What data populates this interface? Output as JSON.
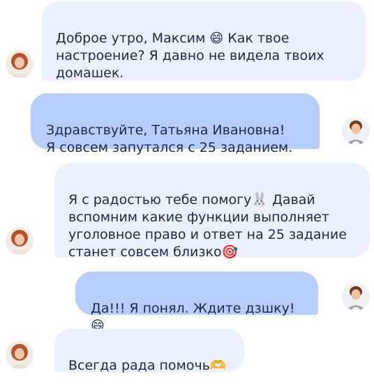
{
  "chat": {
    "messages": [
      {
        "sender": "teacher",
        "direction": "incoming",
        "text": "Доброе утро, Максим 😄 Как твое\nнастроение? Я давно не видела твоих\nдомашек."
      },
      {
        "sender": "student",
        "direction": "outgoing",
        "text": "Здравствуйте, Татьяна Ивановна!\nЯ совсем запутался с 25 заданием."
      },
      {
        "sender": "teacher",
        "direction": "incoming",
        "text": "Я с радостью тебе помогу🐰 Давай\nвспомним какие функции выполняет\nуголовное право и ответ на 25 задание\nстанет совсем близко🎯"
      },
      {
        "sender": "student",
        "direction": "outgoing",
        "text": "Да!!! Я понял. Ждите дзшку!😄"
      },
      {
        "sender": "teacher",
        "direction": "incoming",
        "text": "Всегда рада помочь🫶"
      }
    ]
  },
  "colors": {
    "incoming_bubble": "#ebf1fe",
    "outgoing_bubble": "#b7cdfc",
    "text": "#1c2a4a"
  },
  "icons": {
    "teacher_avatar": "teacher-avatar-icon",
    "student_avatar": "student-avatar-icon"
  }
}
